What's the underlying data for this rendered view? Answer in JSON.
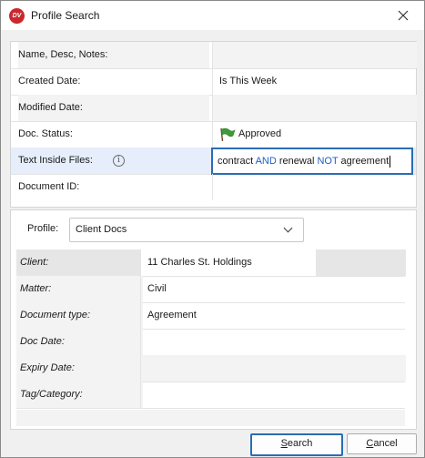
{
  "window": {
    "title": "Profile Search",
    "app_icon_text": "DV"
  },
  "criteria": [
    {
      "label": "Name, Desc, Notes:",
      "value": ""
    },
    {
      "label": "Created Date:",
      "value": "Is This Week"
    },
    {
      "label": "Modified Date:",
      "value": ""
    },
    {
      "label": "Doc. Status:",
      "value": "Approved"
    },
    {
      "label": "Text Inside Files:",
      "value": ""
    },
    {
      "label": "Document ID:",
      "value": ""
    }
  ],
  "query": {
    "t1": "contract ",
    "k1": "AND",
    "t2": " renewal ",
    "k2": "NOT",
    "t3": " agreement"
  },
  "profile": {
    "label": "Profile:",
    "value": "Client Docs"
  },
  "fields": [
    {
      "label": "Client:",
      "value": "11 Charles St. Holdings"
    },
    {
      "label": "Matter:",
      "value": "Civil"
    },
    {
      "label": "Document type:",
      "value": "Agreement"
    },
    {
      "label": "Doc Date:",
      "value": ""
    },
    {
      "label": "Expiry Date:",
      "value": ""
    },
    {
      "label": "Tag/Category:",
      "value": ""
    }
  ],
  "buttons": {
    "search_mnemonic": "S",
    "search_rest": "earch",
    "cancel_mnemonic": "C",
    "cancel_rest": "ancel"
  },
  "colors": {
    "accent": "#2a6db5",
    "keyword": "#1f5fc4",
    "app_icon": "#c8282e",
    "flag": "#3f9a3a"
  }
}
